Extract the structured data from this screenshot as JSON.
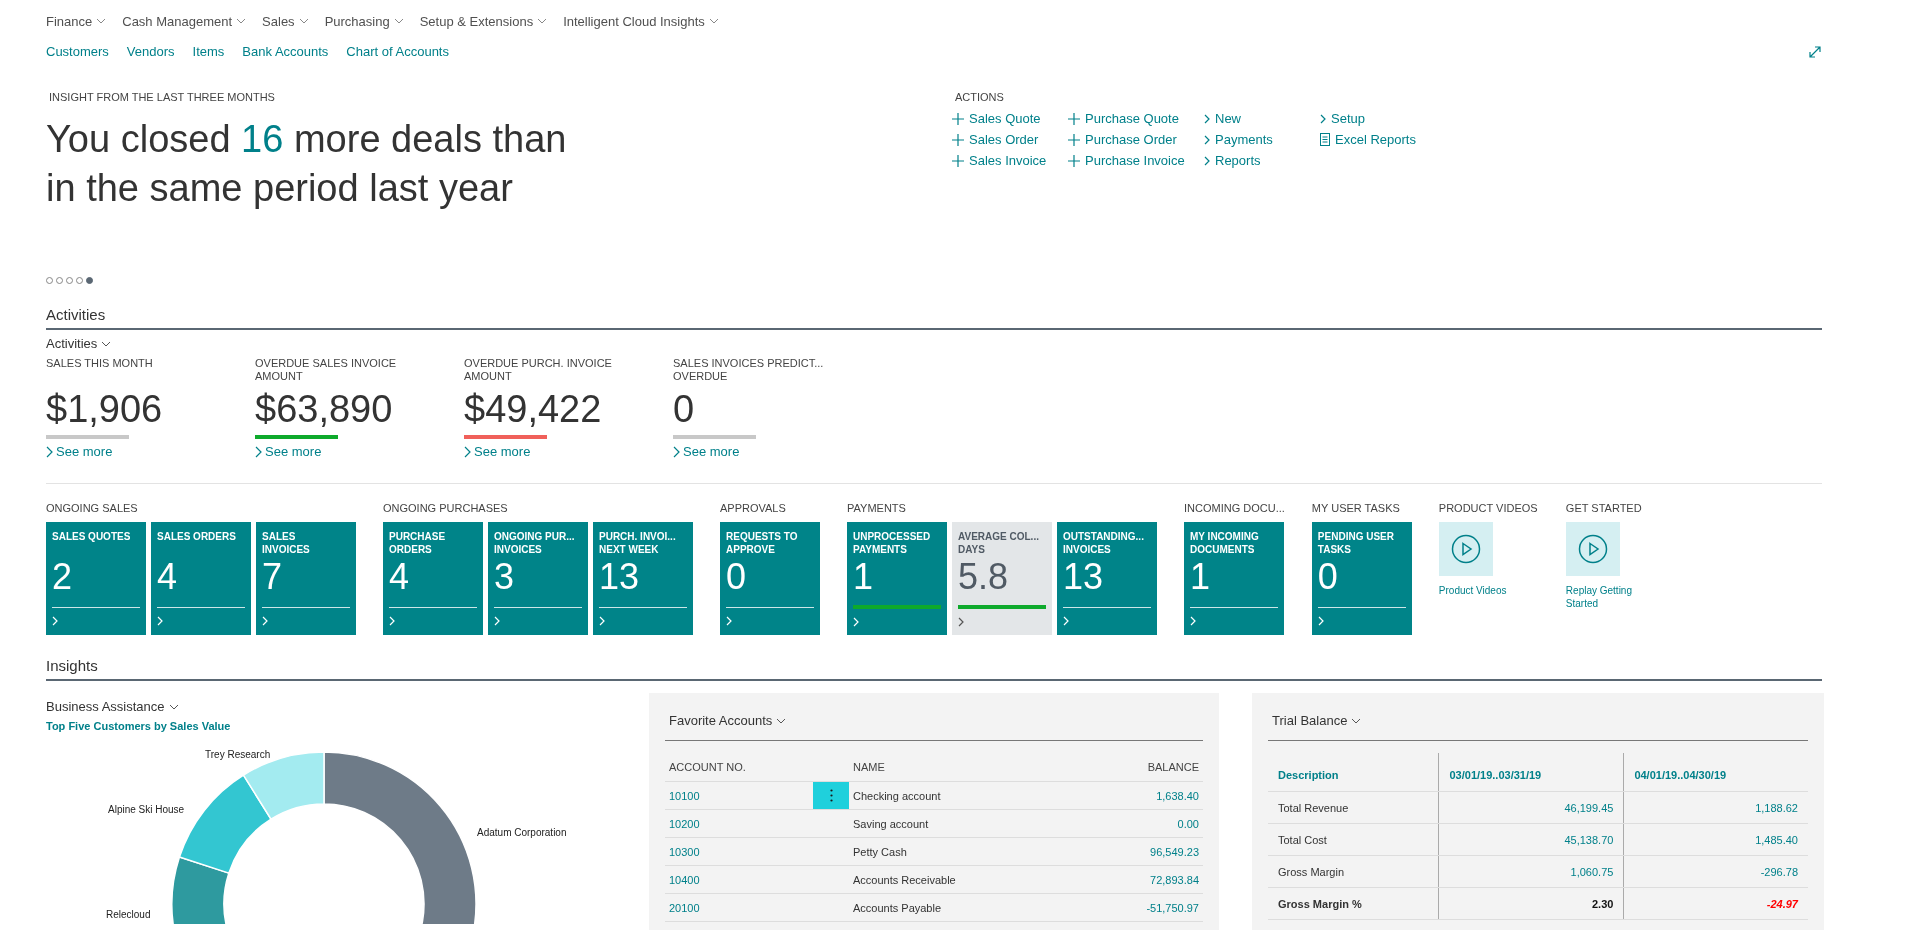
{
  "nav_menus": [
    "Finance",
    "Cash Management",
    "Sales",
    "Purchasing",
    "Setup & Extensions",
    "Intelligent Cloud Insights"
  ],
  "quick_links": [
    "Customers",
    "Vendors",
    "Items",
    "Bank Accounts",
    "Chart of Accounts"
  ],
  "insight": {
    "caption": "INSIGHT FROM THE LAST THREE MONTHS",
    "headline_lines": [
      "You closed **16** more deals than",
      "in the same period last year"
    ]
  },
  "carousel_dots": [
    {
      "selected": false
    },
    {
      "selected": false
    },
    {
      "selected": false
    },
    {
      "selected": false
    },
    {
      "selected": true
    }
  ],
  "actions": {
    "title": "ACTIONS",
    "columns": [
      [
        {
          "kind": "new",
          "label": "Sales Quote"
        },
        {
          "kind": "new",
          "label": "Sales Order"
        },
        {
          "kind": "new",
          "label": "Sales Invoice"
        }
      ],
      [
        {
          "kind": "new",
          "label": "Purchase Quote"
        },
        {
          "kind": "new",
          "label": "Purchase Order"
        },
        {
          "kind": "new",
          "label": "Purchase Invoice"
        }
      ],
      [
        {
          "kind": "menu",
          "label": "New"
        },
        {
          "kind": "menu",
          "label": "Payments"
        },
        {
          "kind": "menu",
          "label": "Reports"
        }
      ],
      [
        {
          "kind": "menu",
          "label": "Setup"
        },
        {
          "kind": "report",
          "label": "Excel Reports"
        }
      ]
    ]
  },
  "activities": {
    "title": "Activities",
    "group_title": "Activities",
    "cues": [
      {
        "label_lines": [
          "SALES THIS MONTH"
        ],
        "value": "$1,906",
        "color": "#c8c8c8",
        "link": "See more"
      },
      {
        "label_lines": [
          "OVERDUE SALES INVOICE",
          "AMOUNT"
        ],
        "value": "$63,890",
        "color": "#0eaa2c",
        "link": "See more"
      },
      {
        "label_lines": [
          "OVERDUE PURCH. INVOICE",
          "AMOUNT"
        ],
        "value": "$49,422",
        "color": "#f0605a",
        "link": "See more"
      },
      {
        "label_lines": [
          "SALES INVOICES PREDICT...",
          "OVERDUE"
        ],
        "value": "0",
        "color": "#c8c8c8",
        "link": "See more"
      }
    ],
    "tile_groups": [
      {
        "title": "ONGOING SALES",
        "tiles": [
          {
            "kind": "count",
            "label_lines": [
              "SALES QUOTES"
            ],
            "value": "2",
            "favorable": false
          },
          {
            "kind": "count",
            "label_lines": [
              "SALES ORDERS"
            ],
            "value": "4",
            "favorable": false
          },
          {
            "kind": "count",
            "label_lines": [
              "SALES",
              "INVOICES"
            ],
            "value": "7",
            "favorable": false
          }
        ]
      },
      {
        "title": "ONGOING PURCHASES",
        "tiles": [
          {
            "kind": "count",
            "label_lines": [
              "PURCHASE",
              "ORDERS"
            ],
            "value": "4",
            "favorable": false
          },
          {
            "kind": "count",
            "label_lines": [
              "ONGOING PUR...",
              "INVOICES"
            ],
            "value": "3",
            "favorable": false
          },
          {
            "kind": "count",
            "label_lines": [
              "PURCH. INVOI...",
              "NEXT WEEK"
            ],
            "value": "13",
            "favorable": false
          }
        ]
      },
      {
        "title": "APPROVALS",
        "tiles": [
          {
            "kind": "count",
            "label_lines": [
              "REQUESTS TO",
              "APPROVE"
            ],
            "value": "0",
            "favorable": false
          }
        ]
      },
      {
        "title": "PAYMENTS",
        "tiles": [
          {
            "kind": "count",
            "label_lines": [
              "UNPROCESSED",
              "PAYMENTS"
            ],
            "value": "1",
            "favorable": true
          },
          {
            "kind": "muted",
            "label_lines": [
              "AVERAGE COL...",
              "DAYS"
            ],
            "value": "5.8",
            "favorable": true
          },
          {
            "kind": "count",
            "label_lines": [
              "OUTSTANDING...",
              "INVOICES"
            ],
            "value": "13",
            "favorable": false
          }
        ]
      },
      {
        "title": "INCOMING DOCU...",
        "tiles": [
          {
            "kind": "count",
            "label_lines": [
              "MY INCOMING",
              "DOCUMENTS"
            ],
            "value": "1",
            "favorable": false
          }
        ]
      },
      {
        "title": "MY USER TASKS",
        "tiles": [
          {
            "kind": "count",
            "label_lines": [
              "PENDING USER",
              "TASKS"
            ],
            "value": "0",
            "favorable": false
          }
        ]
      },
      {
        "title": "PRODUCT VIDEOS",
        "tiles": [
          {
            "kind": "video",
            "label_lines": [
              "Product Videos"
            ]
          }
        ]
      },
      {
        "title": "GET STARTED",
        "tiles": [
          {
            "kind": "video",
            "label_lines": [
              "Replay Getting",
              "Started"
            ]
          }
        ]
      }
    ]
  },
  "insights": {
    "title": "Insights",
    "business_assistance": {
      "title": "Business Assistance",
      "chart_title": "Top Five Customers by Sales Value",
      "slice_labels": [
        "Adatum Corporation",
        "Trey Research",
        "Alpine Ski House",
        "Relecloud"
      ]
    },
    "favorite_accounts": {
      "title": "Favorite Accounts",
      "columns": [
        "ACCOUNT NO.",
        "NAME",
        "BALANCE"
      ],
      "rows": [
        {
          "account": "10100",
          "name": "Checking account",
          "balance": "1,638.40",
          "selected": true
        },
        {
          "account": "10200",
          "name": "Saving account",
          "balance": "0.00",
          "selected": false
        },
        {
          "account": "10300",
          "name": "Petty Cash",
          "balance": "96,549.23",
          "selected": false
        },
        {
          "account": "10400",
          "name": "Accounts Receivable",
          "balance": "72,893.84",
          "selected": false
        },
        {
          "account": "20100",
          "name": "Accounts Payable",
          "balance": "-51,750.97",
          "selected": false
        }
      ]
    },
    "trial_balance": {
      "title": "Trial Balance",
      "columns": [
        "Description",
        "03/01/19..03/31/19",
        "04/01/19..04/30/19"
      ],
      "rows": [
        {
          "description": "Total Revenue",
          "bold": false,
          "values": [
            {
              "text": "46,199.45",
              "unfavorable": false
            },
            {
              "text": "1,188.62",
              "unfavorable": false
            }
          ]
        },
        {
          "description": "Total Cost",
          "bold": false,
          "values": [
            {
              "text": "45,138.70",
              "unfavorable": false
            },
            {
              "text": "1,485.40",
              "unfavorable": false
            }
          ]
        },
        {
          "description": "Gross Margin",
          "bold": false,
          "values": [
            {
              "text": "1,060.75",
              "unfavorable": false
            },
            {
              "text": "-296.78",
              "unfavorable": false
            }
          ]
        },
        {
          "description": "Gross Margin %",
          "bold": true,
          "values": [
            {
              "text": "2.30",
              "unfavorable": false
            },
            {
              "text": "-24.97",
              "unfavorable": true
            }
          ]
        }
      ]
    }
  }
}
